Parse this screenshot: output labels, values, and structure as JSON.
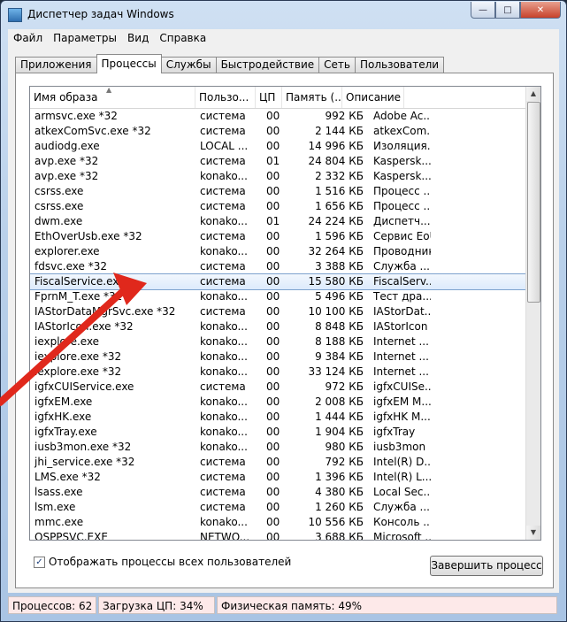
{
  "window": {
    "title": "Диспетчер задач Windows",
    "minimize": "—",
    "maximize": "□",
    "close": "✕"
  },
  "menu": [
    "Файл",
    "Параметры",
    "Вид",
    "Справка"
  ],
  "tabs": [
    "Приложения",
    "Процессы",
    "Службы",
    "Быстродействие",
    "Сеть",
    "Пользователи"
  ],
  "columns": [
    "Имя образа",
    "Пользо...",
    "ЦП",
    "Память (...",
    "Описание"
  ],
  "processes": [
    {
      "name": "armsvc.exe *32",
      "user": "система",
      "cpu": "00",
      "mem": "992 КБ",
      "desc": "Adobe Ac..."
    },
    {
      "name": "atkexComSvc.exe *32",
      "user": "система",
      "cpu": "00",
      "mem": "2 144 КБ",
      "desc": "atkexCom..."
    },
    {
      "name": "audiodg.exe",
      "user": "LOCAL ...",
      "cpu": "00",
      "mem": "14 996 КБ",
      "desc": "Изоляция..."
    },
    {
      "name": "avp.exe *32",
      "user": "система",
      "cpu": "01",
      "mem": "24 804 КБ",
      "desc": "Kaspersk..."
    },
    {
      "name": "avp.exe *32",
      "user": "konako...",
      "cpu": "00",
      "mem": "2 332 КБ",
      "desc": "Kaspersk..."
    },
    {
      "name": "csrss.exe",
      "user": "система",
      "cpu": "00",
      "mem": "1 516 КБ",
      "desc": "Процесс ..."
    },
    {
      "name": "csrss.exe",
      "user": "система",
      "cpu": "00",
      "mem": "1 656 КБ",
      "desc": "Процесс ..."
    },
    {
      "name": "dwm.exe",
      "user": "konako...",
      "cpu": "01",
      "mem": "24 224 КБ",
      "desc": "Диспетч..."
    },
    {
      "name": "EthOverUsb.exe *32",
      "user": "система",
      "cpu": "00",
      "mem": "1 596 КБ",
      "desc": "Сервис EoU"
    },
    {
      "name": "explorer.exe",
      "user": "konako...",
      "cpu": "00",
      "mem": "32 264 КБ",
      "desc": "Проводник"
    },
    {
      "name": "fdsvc.exe *32",
      "user": "система",
      "cpu": "00",
      "mem": "3 388 КБ",
      "desc": "Служба ..."
    },
    {
      "name": "FiscalService.exe",
      "user": "система",
      "cpu": "00",
      "mem": "15 580 КБ",
      "desc": "FiscalServ..."
    },
    {
      "name": "FprnM_T.exe *32",
      "user": "konako...",
      "cpu": "00",
      "mem": "5 496 КБ",
      "desc": "Тест дра..."
    },
    {
      "name": "IAStorDataMgrSvc.exe *32",
      "user": "система",
      "cpu": "00",
      "mem": "10 100 КБ",
      "desc": "IAStorDat..."
    },
    {
      "name": "IAStorIcon.exe *32",
      "user": "konako...",
      "cpu": "00",
      "mem": "8 848 КБ",
      "desc": "IAStorIcon"
    },
    {
      "name": "iexplore.exe",
      "user": "konako...",
      "cpu": "00",
      "mem": "8 188 КБ",
      "desc": "Internet ..."
    },
    {
      "name": "iexplore.exe *32",
      "user": "konako...",
      "cpu": "00",
      "mem": "9 384 КБ",
      "desc": "Internet ..."
    },
    {
      "name": "iexplore.exe *32",
      "user": "konako...",
      "cpu": "00",
      "mem": "33 124 КБ",
      "desc": "Internet ..."
    },
    {
      "name": "igfxCUIService.exe",
      "user": "система",
      "cpu": "00",
      "mem": "972 КБ",
      "desc": "igfxCUISe..."
    },
    {
      "name": "igfxEM.exe",
      "user": "konako...",
      "cpu": "00",
      "mem": "2 008 КБ",
      "desc": "igfxEM M..."
    },
    {
      "name": "igfxHK.exe",
      "user": "konako...",
      "cpu": "00",
      "mem": "1 444 КБ",
      "desc": "igfxHK M..."
    },
    {
      "name": "igfxTray.exe",
      "user": "konako...",
      "cpu": "00",
      "mem": "1 904 КБ",
      "desc": "igfxTray"
    },
    {
      "name": "iusb3mon.exe *32",
      "user": "konako...",
      "cpu": "00",
      "mem": "980 КБ",
      "desc": "iusb3mon"
    },
    {
      "name": "jhi_service.exe *32",
      "user": "система",
      "cpu": "00",
      "mem": "792 КБ",
      "desc": "Intel(R) D..."
    },
    {
      "name": "LMS.exe *32",
      "user": "система",
      "cpu": "00",
      "mem": "1 396 КБ",
      "desc": "Intel(R) L..."
    },
    {
      "name": "lsass.exe",
      "user": "система",
      "cpu": "00",
      "mem": "4 380 КБ",
      "desc": "Local Sec..."
    },
    {
      "name": "lsm.exe",
      "user": "система",
      "cpu": "00",
      "mem": "1 260 КБ",
      "desc": "Служба ..."
    },
    {
      "name": "mmc.exe",
      "user": "konako...",
      "cpu": "00",
      "mem": "10 556 КБ",
      "desc": "Консоль ..."
    },
    {
      "name": "OSPPSVC.EXE",
      "user": "NETWO...",
      "cpu": "00",
      "mem": "3 688 КБ",
      "desc": "Microsoft ..."
    }
  ],
  "selected_index": 11,
  "show_all_label": "Отображать процессы всех пользователей",
  "end_process_label": "Завершить процесс",
  "status": {
    "processes": "Процессов: 62",
    "cpu": "Загрузка ЦП: 34%",
    "memory": "Физическая память: 49%"
  },
  "colors": {
    "annotation_arrow": "#e0281c",
    "selection": "#dceafc"
  }
}
